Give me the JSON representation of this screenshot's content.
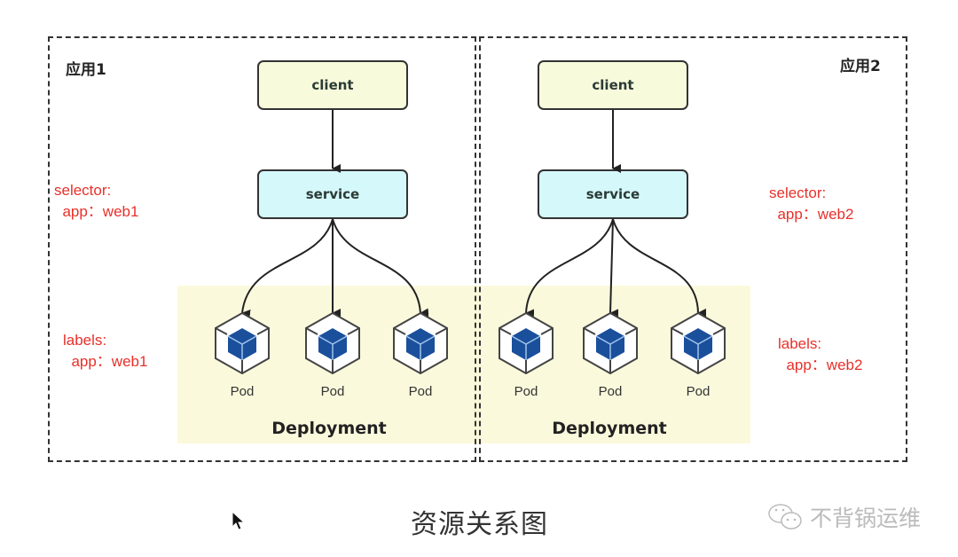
{
  "apps": [
    {
      "title": "应用1",
      "client_label": "client",
      "service_label": "service",
      "selector": "selector:\n  app：web1",
      "labels": "labels:\n  app：web1",
      "pods": [
        "Pod",
        "Pod",
        "Pod"
      ],
      "deployment_label": "Deployment"
    },
    {
      "title": "应用2",
      "client_label": "client",
      "service_label": "service",
      "selector": "selector:\n  app：web2",
      "labels": "labels:\n  app：web2",
      "pods": [
        "Pod",
        "Pod",
        "Pod"
      ],
      "deployment_label": "Deployment"
    }
  ],
  "caption": "资源关系图",
  "watermark": {
    "icon": "wechat-icon",
    "text": "不背锅运维"
  },
  "colors": {
    "client_fill": "#f7fbdc",
    "service_fill": "#d5f8fb",
    "deployment_fill": "#fbf9dc",
    "annotation_red": "#e8302a",
    "pod_cube": "#1a4f9c"
  }
}
